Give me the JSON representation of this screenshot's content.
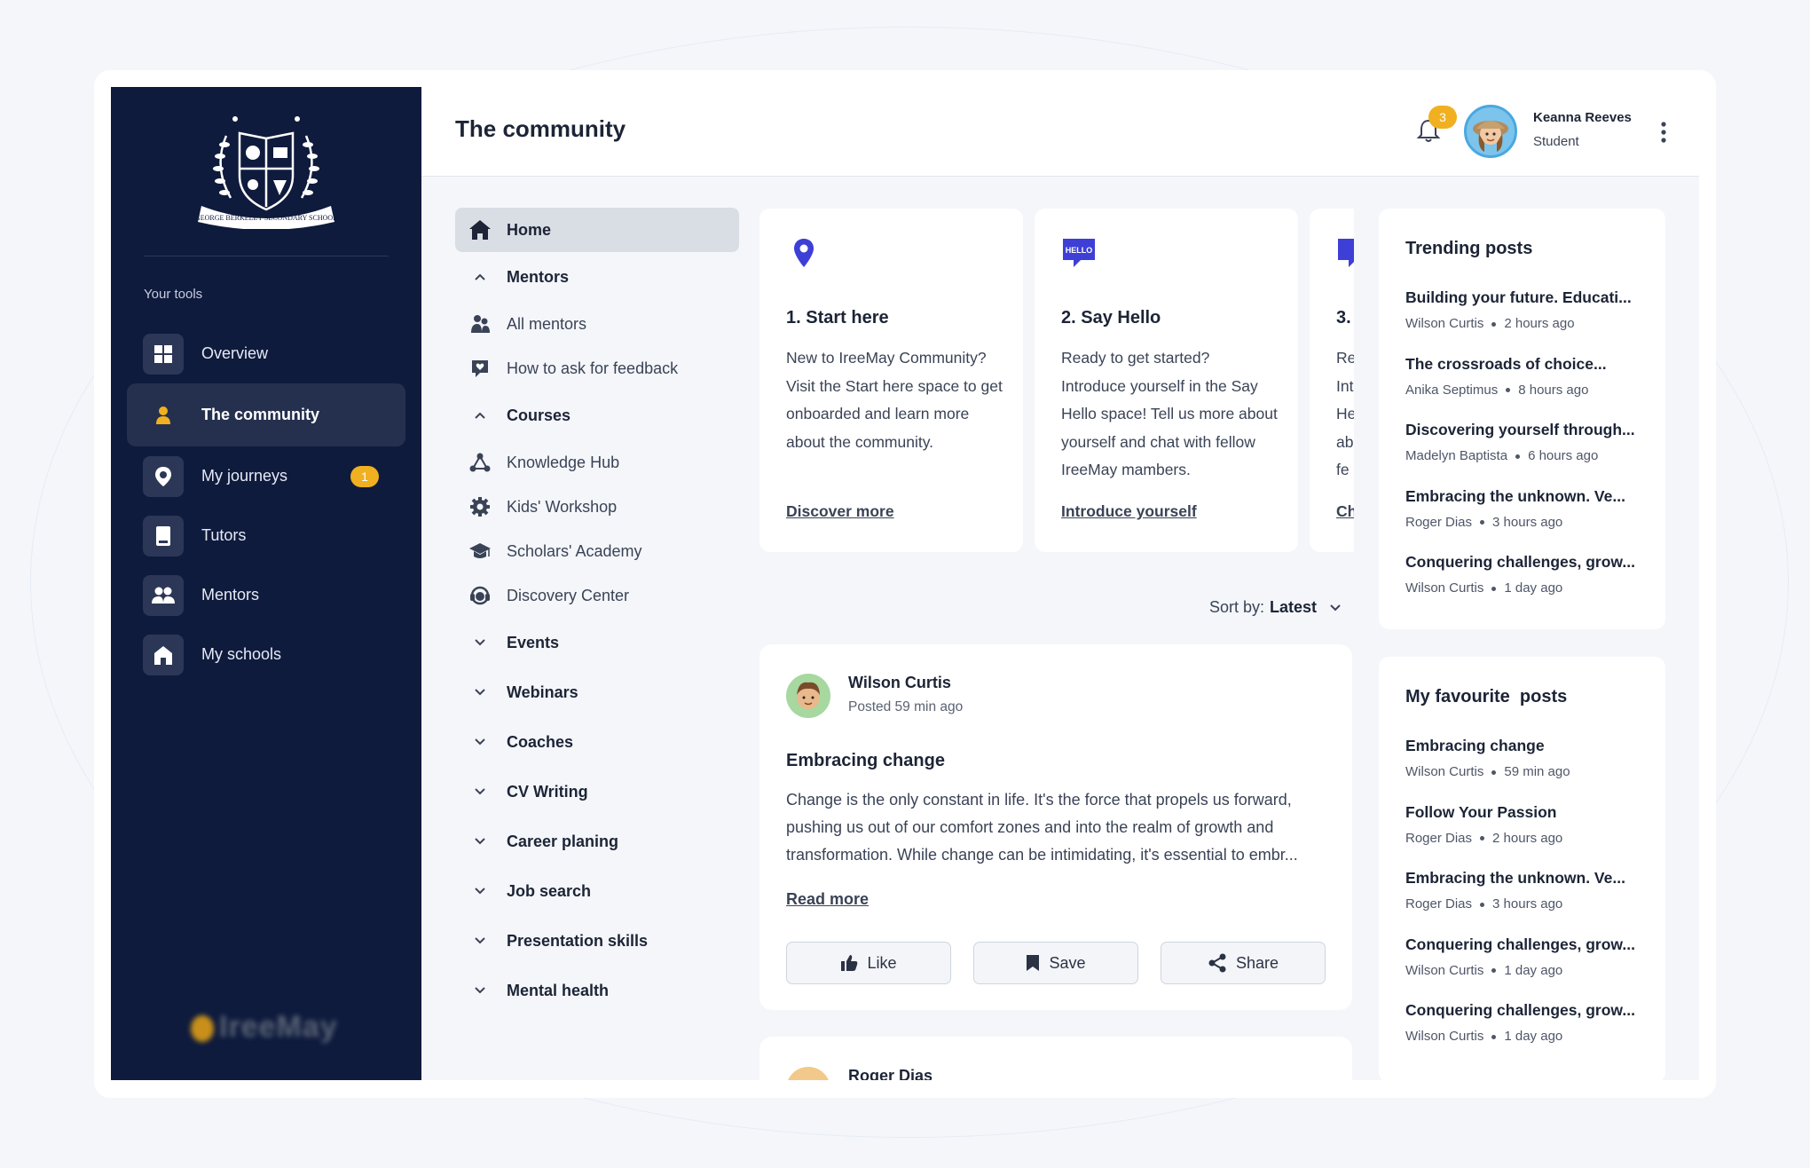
{
  "sidebar": {
    "tools_label": "Your tools",
    "items": [
      {
        "label": "Overview",
        "icon": "grid-icon"
      },
      {
        "label": "The community",
        "icon": "person-icon",
        "active": true
      },
      {
        "label": "My journeys",
        "icon": "map-pin-icon",
        "badge": "1"
      },
      {
        "label": "Tutors",
        "icon": "book-icon"
      },
      {
        "label": "Mentors",
        "icon": "people-icon"
      },
      {
        "label": "My schools",
        "icon": "school-icon"
      }
    ],
    "brand": "IreeMay"
  },
  "header": {
    "title": "The community",
    "notifications": "3",
    "user_name": "Keanna Reeves",
    "user_role": "Student"
  },
  "community_nav": {
    "home": "Home",
    "mentors_section": "Mentors",
    "mentors_items": [
      "All mentors",
      "How to ask for feedback"
    ],
    "courses_section": "Courses",
    "courses_items": [
      "Knowledge Hub",
      "Kids' Workshop",
      "Scholars' Academy",
      "Discovery Center"
    ],
    "sections": [
      "Events",
      "Webinars",
      "Coaches",
      "CV Writing",
      "Career planing",
      "Job search",
      "Presentation skills",
      "Mental health"
    ]
  },
  "cards": [
    {
      "title": "1. Start here",
      "body": "New to IreeMay Community? Visit the Start here space to get onboarded and learn more about the community.",
      "link": "Discover more",
      "icon": "map-pin-icon"
    },
    {
      "title": "2. Say Hello",
      "body": "Ready to get started? Introduce yourself in the Say Hello space! Tell us more about yourself and chat with fellow IreeMay mambers.",
      "link": "Introduce yourself",
      "icon": "hello-bubble-icon",
      "icon_text": "HELLO"
    },
    {
      "title": "3.",
      "body": "Re Int He ab fe",
      "link": "Ch",
      "icon": "chat-icon"
    }
  ],
  "sort": {
    "label": "Sort by:",
    "value": "Latest"
  },
  "posts": [
    {
      "author": "Wilson Curtis",
      "time": "Posted 59 min ago",
      "title": "Embracing change",
      "body": "Change is the only constant in life. It's the force that propels us forward, pushing us out of our comfort zones and into the realm of growth and transformation. While change can be intimidating, it's essential to embr...",
      "read_more": "Read more",
      "actions": {
        "like": "Like",
        "save": "Save",
        "share": "Share"
      }
    },
    {
      "author": "Roger Dias"
    }
  ],
  "trending": {
    "title": "Trending posts",
    "items": [
      {
        "title": "Building your future. Educati...",
        "author": "Wilson Curtis",
        "time": "2 hours ago"
      },
      {
        "title": "The crossroads of choice...",
        "author": "Anika Septimus",
        "time": "8 hours ago"
      },
      {
        "title": "Discovering yourself through...",
        "author": "Madelyn Baptista",
        "time": "6 hours ago"
      },
      {
        "title": "Embracing the unknown. Ve...",
        "author": "Roger Dias",
        "time": "3 hours ago"
      },
      {
        "title": "Conquering challenges, grow...",
        "author": "Wilson Curtis",
        "time": "1 day ago"
      }
    ]
  },
  "favourites": {
    "title": "My favourite  posts",
    "items": [
      {
        "title": "Embracing change",
        "author": "Wilson Curtis",
        "time": "59 min ago"
      },
      {
        "title": "Follow Your Passion",
        "author": "Roger Dias",
        "time": "2 hours ago"
      },
      {
        "title": "Embracing the unknown. Ve...",
        "author": "Roger Dias",
        "time": "3 hours ago"
      },
      {
        "title": "Conquering challenges, grow...",
        "author": "Wilson Curtis",
        "time": "1 day ago"
      },
      {
        "title": "Conquering challenges, grow...",
        "author": "Wilson Curtis",
        "time": "1 day ago"
      }
    ]
  },
  "colors": {
    "sidebar": "#0f1b3d",
    "accent": "#3d3fd6",
    "badge": "#f0b020"
  }
}
